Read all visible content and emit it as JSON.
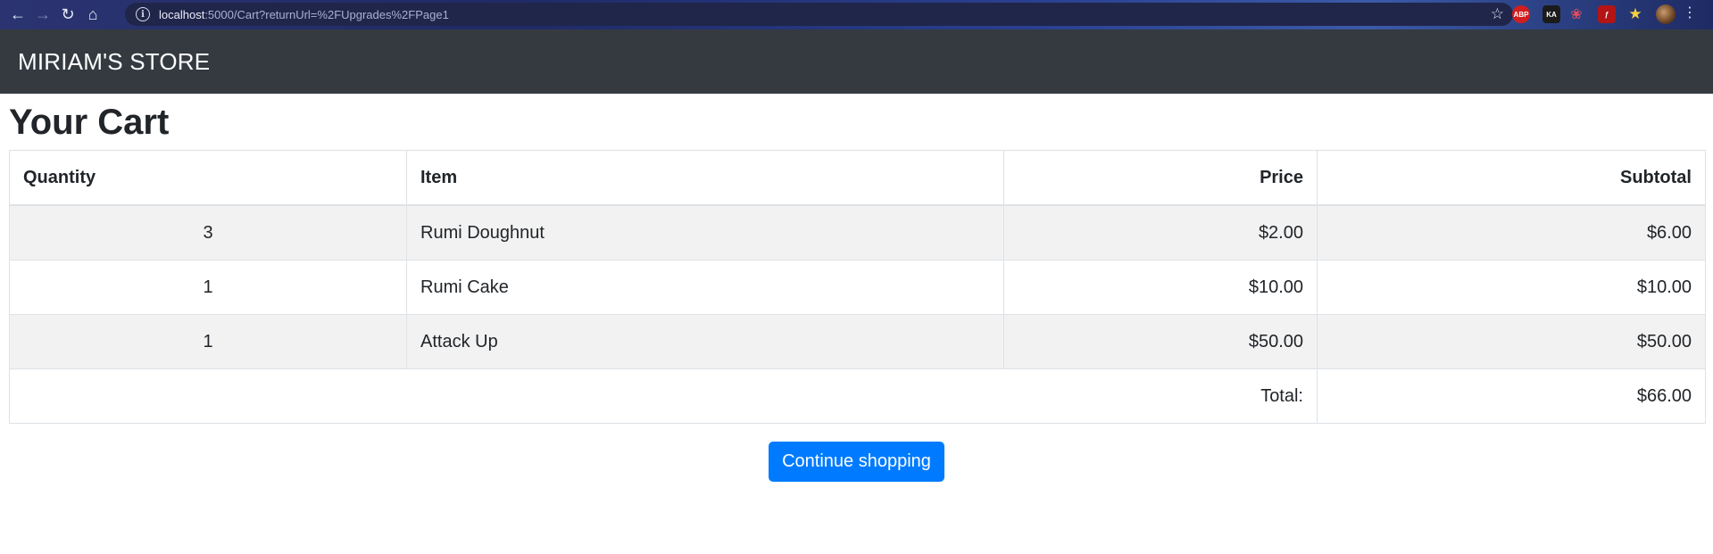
{
  "browser": {
    "url_host": "localhost",
    "url_rest": ":5000/Cart?returnUrl=%2FUpgrades%2FPage1",
    "extensions": [
      "ABP",
      "KA"
    ]
  },
  "navbar": {
    "brand": "MIRIAM'S STORE"
  },
  "page": {
    "title": "Your Cart"
  },
  "cart": {
    "headers": {
      "quantity": "Quantity",
      "item": "Item",
      "price": "Price",
      "subtotal": "Subtotal"
    },
    "rows": [
      {
        "quantity": "3",
        "item": "Rumi Doughnut",
        "price": "$2.00",
        "subtotal": "$6.00"
      },
      {
        "quantity": "1",
        "item": "Rumi Cake",
        "price": "$10.00",
        "subtotal": "$10.00"
      },
      {
        "quantity": "1",
        "item": "Attack Up",
        "price": "$50.00",
        "subtotal": "$50.00"
      }
    ],
    "total_label": "Total:",
    "total_value": "$66.00"
  },
  "actions": {
    "continue_label": "Continue shopping"
  }
}
